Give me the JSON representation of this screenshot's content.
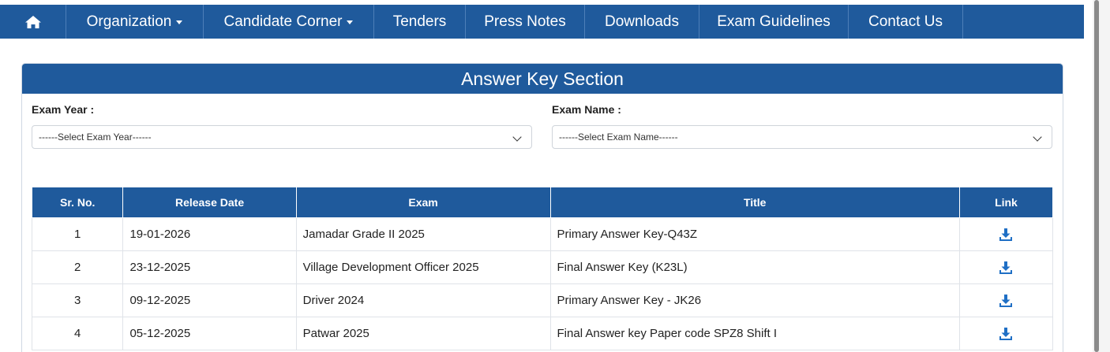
{
  "nav": {
    "home_icon": "home-icon",
    "items": [
      {
        "label": "Organization",
        "dropdown": true
      },
      {
        "label": "Candidate Corner",
        "dropdown": true
      },
      {
        "label": "Tenders"
      },
      {
        "label": "Press Notes"
      },
      {
        "label": "Downloads"
      },
      {
        "label": "Exam Guidelines"
      },
      {
        "label": "Contact Us"
      }
    ]
  },
  "section": {
    "title": "Answer Key Section"
  },
  "filters": {
    "year_label": "Exam Year :",
    "year_value": "------Select Exam Year------",
    "name_label": "Exam Name :",
    "name_value": "------Select Exam Name------"
  },
  "table": {
    "headers": [
      "Sr. No.",
      "Release Date",
      "Exam",
      "Title",
      "Link"
    ],
    "rows": [
      {
        "sr": "1",
        "date": "19-01-2026",
        "exam": "Jamadar Grade II 2025",
        "title": "Primary Answer Key-Q43Z",
        "link_icon": "download-icon"
      },
      {
        "sr": "2",
        "date": "23-12-2025",
        "exam": "Village Development Officer 2025",
        "title": "Final Answer Key (K23L)",
        "link_icon": "download-icon"
      },
      {
        "sr": "3",
        "date": "09-12-2025",
        "exam": "Driver 2024",
        "title": "Primary Answer Key - JK26",
        "link_icon": "download-icon"
      },
      {
        "sr": "4",
        "date": "05-12-2025",
        "exam": "Patwar 2025",
        "title": "Final Answer key Paper code SPZ8 Shift I",
        "link_icon": "download-icon"
      }
    ]
  },
  "colors": {
    "brand_blue": "#1f5a9c",
    "icon_blue": "#1f6fc5"
  }
}
